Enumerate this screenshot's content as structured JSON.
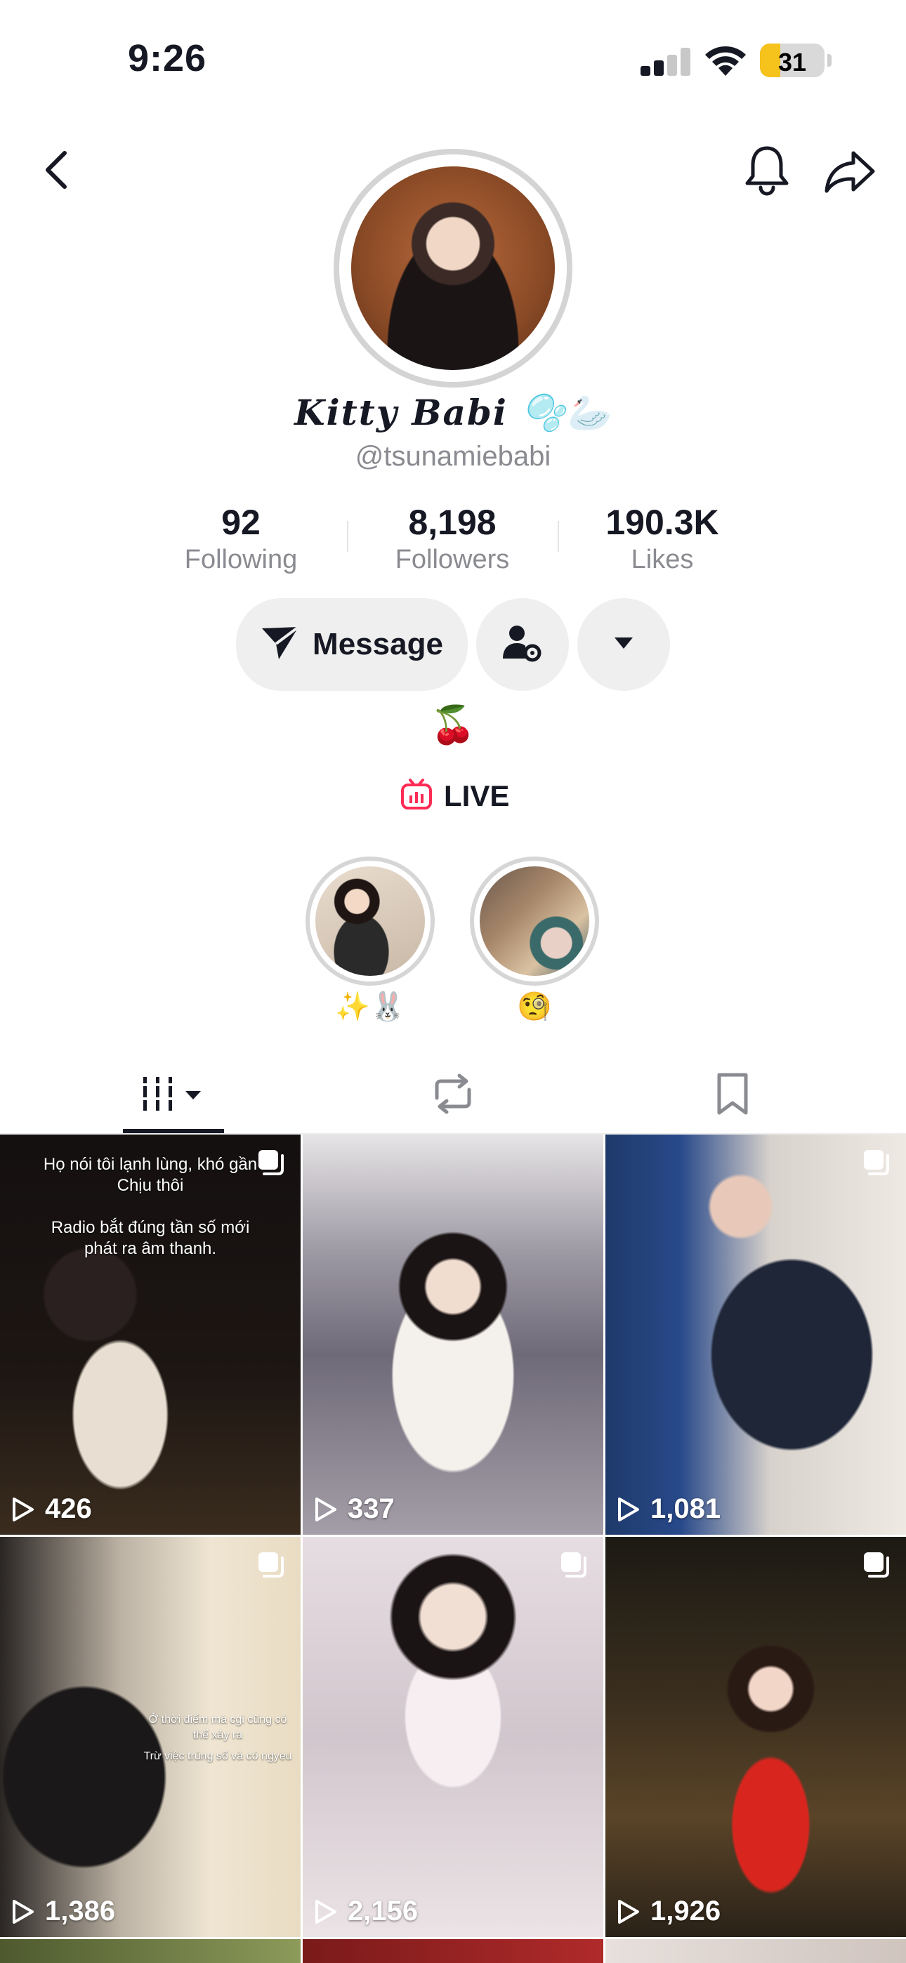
{
  "status_bar": {
    "time": "9:26",
    "battery": "31",
    "battery_level": 0.31
  },
  "profile": {
    "display_name": "Kitty Babi 🫧🦢",
    "username": "@tsunamiebabi",
    "bio": "🍒",
    "live_label": "LIVE"
  },
  "stats": [
    {
      "value": "92",
      "label": "Following"
    },
    {
      "value": "8,198",
      "label": "Followers"
    },
    {
      "value": "190.3K",
      "label": "Likes"
    }
  ],
  "actions": {
    "message_label": "Message"
  },
  "highlights": [
    {
      "label": "✨🐰"
    },
    {
      "label": "🧐"
    }
  ],
  "tabs": [
    "videos-tab",
    "reposts-tab",
    "favorites-tab"
  ],
  "grid": {
    "videos": [
      {
        "views": "426",
        "caption_lines": [
          "Họ nói tôi lạnh lùng, khó gần",
          "Chịu thôi",
          "",
          "Radio bắt đúng tần số mới",
          "phát ra âm thanh."
        ]
      },
      {
        "views": "337"
      },
      {
        "views": "1,081"
      },
      {
        "views": "1,386",
        "caption_lines": [
          "Ở thời điểm mà cgi cũng có",
          "thể xảy ra",
          "Trừ việc trúng số và có ngyeu"
        ]
      },
      {
        "views": "2,156"
      },
      {
        "views": "1,926"
      }
    ]
  },
  "colors": {
    "text": "#161823",
    "secondary": "#8a8b91",
    "button_bg": "#efefef",
    "live_red": "#fe2c55",
    "battery_yellow": "#f6c21c"
  }
}
